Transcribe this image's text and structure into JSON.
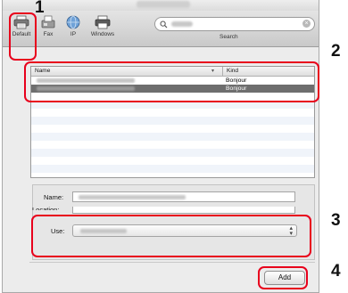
{
  "toolbar": {
    "buttons": [
      {
        "label": "Default",
        "icon": "printer-icon"
      },
      {
        "label": "Fax",
        "icon": "fax-icon"
      },
      {
        "label": "IP",
        "icon": "globe-icon"
      },
      {
        "label": "Windows",
        "icon": "windows-printer-icon"
      }
    ],
    "search_label": "Search",
    "search_placeholder": "",
    "clear_icon": "close-circle-icon"
  },
  "list": {
    "columns": [
      "Name",
      "Kind"
    ],
    "rows": [
      {
        "kind": "Bonjour",
        "selected": false
      },
      {
        "kind": "Bonjour",
        "selected": true
      }
    ],
    "selection_color": "#6e6e6e"
  },
  "form": {
    "name_label": "Name:",
    "location_label": "Location:",
    "use_label": "Use:"
  },
  "add_label": "Add",
  "callouts": {
    "colors": {
      "highlight": "#e8001c"
    },
    "step1": "1",
    "step2": "2",
    "step3": "3",
    "step4": "4"
  }
}
